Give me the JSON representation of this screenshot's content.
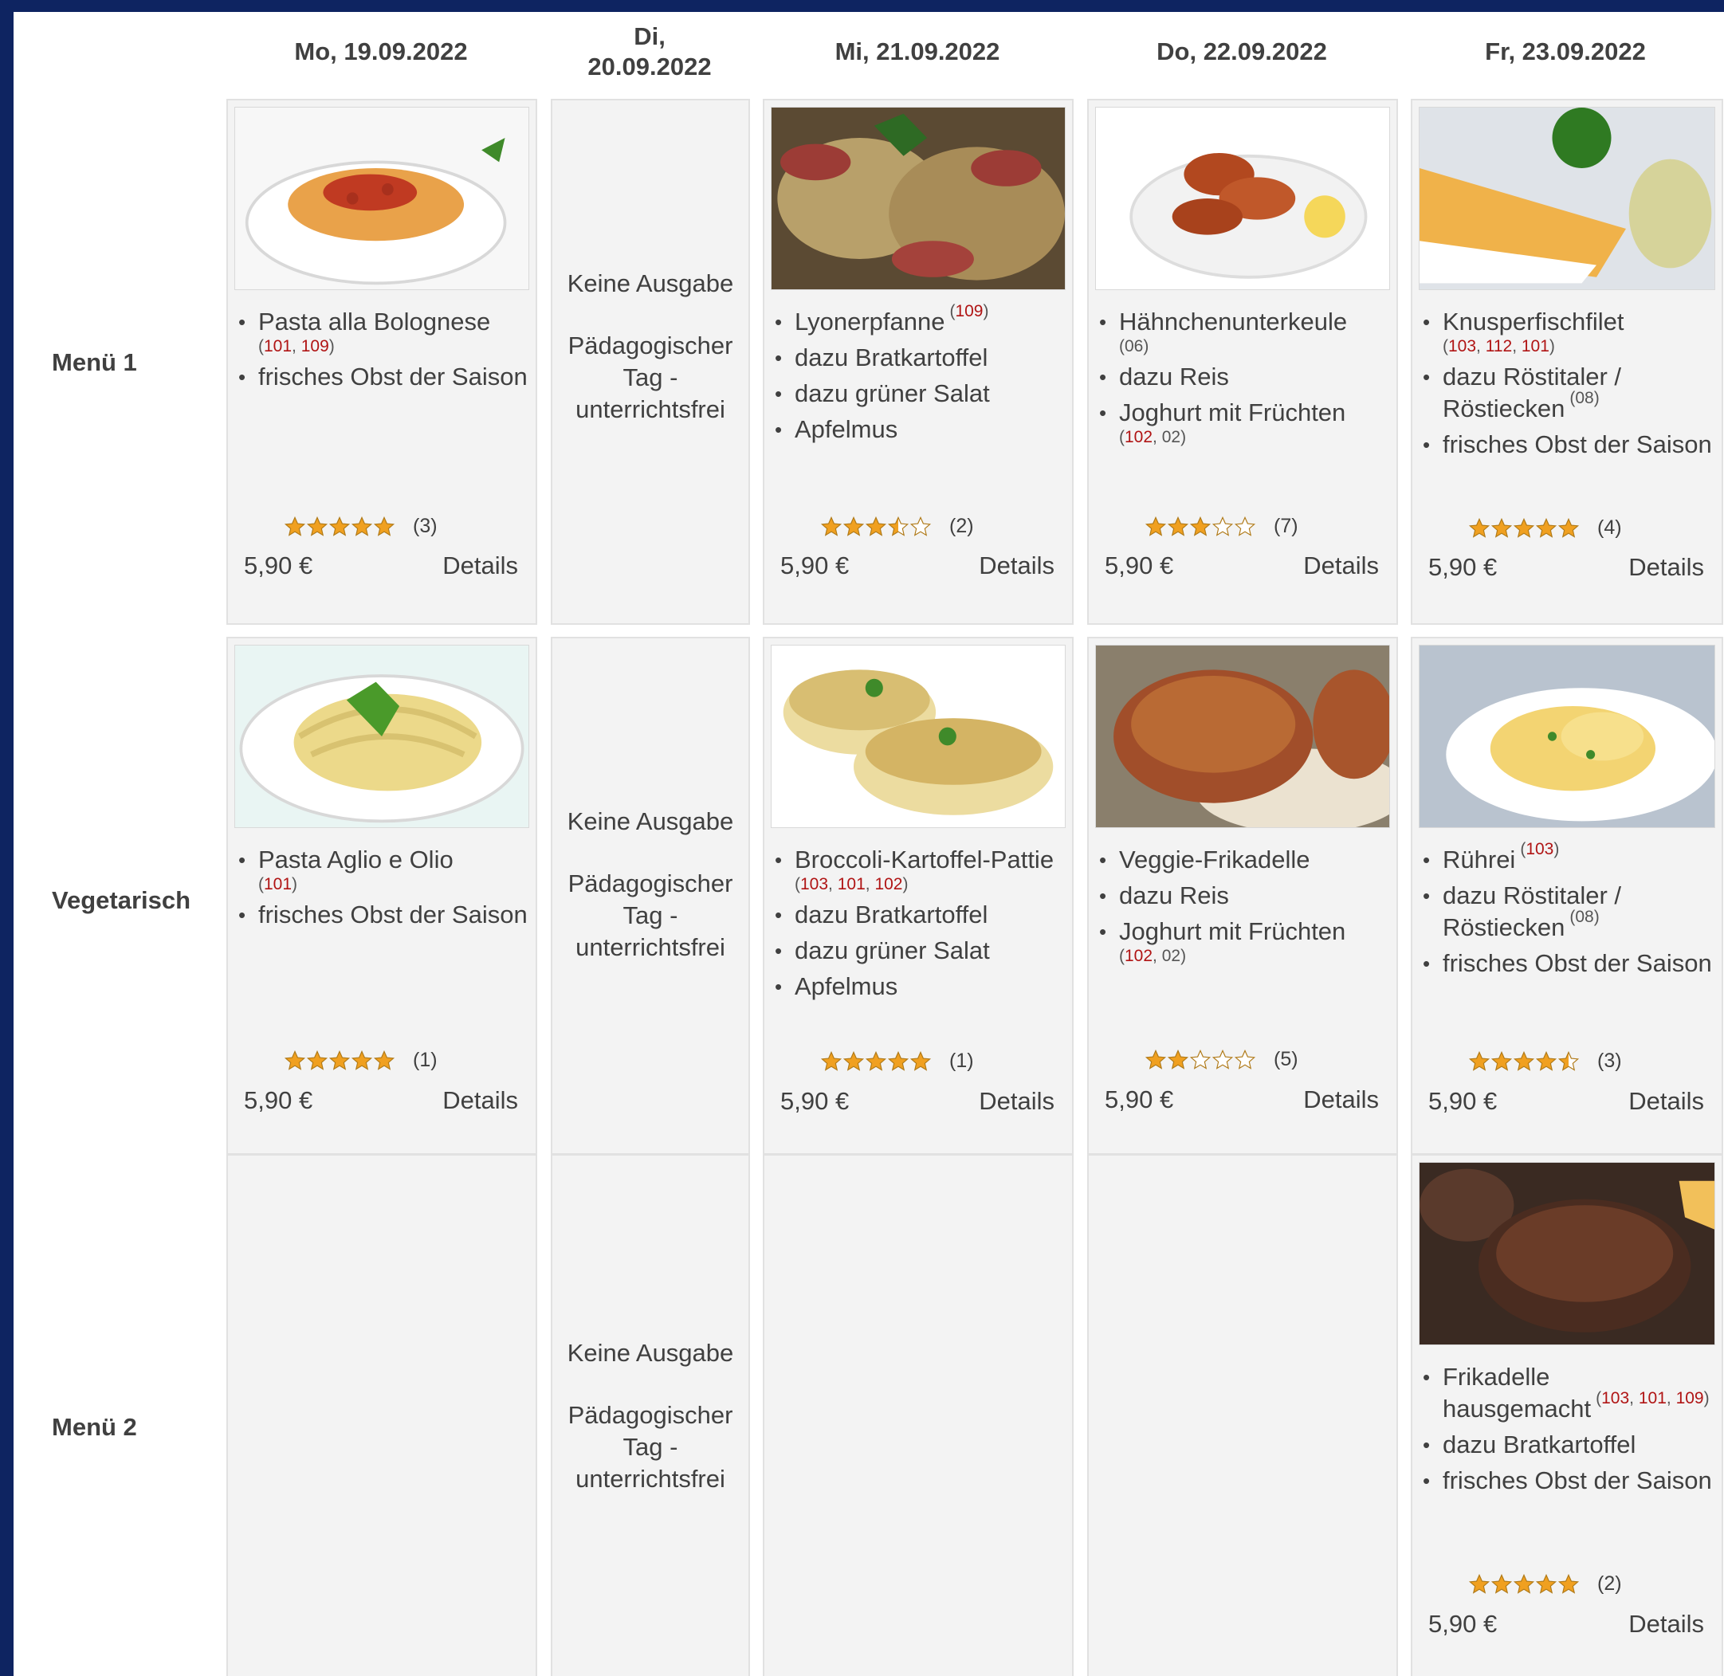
{
  "days": [
    {
      "label": "Mo, 19.09.2022"
    },
    {
      "label": "Di,\n20.09.2022"
    },
    {
      "label": "Mi, 21.09.2022"
    },
    {
      "label": "Do, 22.09.2022"
    },
    {
      "label": "Fr, 23.09.2022"
    }
  ],
  "rows": [
    {
      "label": "Menü 1"
    },
    {
      "label": "Vegetarisch"
    },
    {
      "label": "Menü 2"
    }
  ],
  "closed": {
    "line1": "Keine Ausgabe",
    "line2": "Pädagogischer Tag - unterrichtsfrei"
  },
  "details_label": "Details",
  "colors": {
    "background": "#0e2461",
    "card": "#f3f3f3",
    "allergen": "#b01414",
    "star": "#f0a020"
  },
  "cards": {
    "m1_mo": {
      "image_icon": "pasta-bolognese-photo",
      "dishes": [
        {
          "name": "Pasta alla Bolognese",
          "allergens": "(101, 109)"
        },
        {
          "name": "frisches Obst der Saison",
          "allergens": ""
        }
      ],
      "rating": 5,
      "rating_count": "(3)",
      "price": "5,90 €"
    },
    "m1_mi": {
      "image_icon": "lyonerpfanne-photo",
      "dishes": [
        {
          "name": "Lyonerpfanne",
          "allergens": "(109)"
        },
        {
          "name": "dazu Bratkartoffel",
          "allergens": ""
        },
        {
          "name": "dazu grüner Salat",
          "allergens": ""
        },
        {
          "name": "Apfelmus",
          "allergens": ""
        }
      ],
      "rating": 3.5,
      "rating_count": "(2)",
      "price": "5,90 €"
    },
    "m1_do": {
      "image_icon": "chicken-legs-photo",
      "dishes": [
        {
          "name": "Hähnchenunterkeule",
          "allergens": "(06)"
        },
        {
          "name": "dazu Reis",
          "allergens": ""
        },
        {
          "name": "Joghurt mit Früchten",
          "allergens": "(102, 02)"
        }
      ],
      "rating": 3,
      "rating_count": "(7)",
      "price": "5,90 €"
    },
    "m1_fr": {
      "image_icon": "fish-fillet-photo",
      "dishes": [
        {
          "name": "Knusperfischfilet",
          "allergens": "(103, 112, 101)"
        },
        {
          "name": "dazu Röstitaler / Röstiecken",
          "allergens": "(08)"
        },
        {
          "name": "frisches Obst der Saison",
          "allergens": ""
        }
      ],
      "rating": 5,
      "rating_count": "(4)",
      "price": "5,90 €"
    },
    "veg_mo": {
      "image_icon": "pasta-aglio-olio-photo",
      "dishes": [
        {
          "name": "Pasta Aglio e Olio",
          "allergens": "(101)"
        },
        {
          "name": "frisches Obst der Saison",
          "allergens": ""
        }
      ],
      "rating": 5,
      "rating_count": "(1)",
      "price": "5,90 €"
    },
    "veg_mi": {
      "image_icon": "broccoli-pattie-photo",
      "dishes": [
        {
          "name": "Broccoli-Kartoffel-Pattie",
          "allergens": "(103, 101, 102)"
        },
        {
          "name": "dazu Bratkartoffel",
          "allergens": ""
        },
        {
          "name": "dazu grüner Salat",
          "allergens": ""
        },
        {
          "name": "Apfelmus",
          "allergens": ""
        }
      ],
      "rating": 5,
      "rating_count": "(1)",
      "price": "5,90 €"
    },
    "veg_do": {
      "image_icon": "veggie-patty-photo",
      "dishes": [
        {
          "name": "Veggie-Frikadelle",
          "allergens": ""
        },
        {
          "name": "dazu Reis",
          "allergens": ""
        },
        {
          "name": "Joghurt mit Früchten",
          "allergens": "(102, 02)"
        }
      ],
      "rating": 2,
      "rating_count": "(5)",
      "price": "5,90 €"
    },
    "veg_fr": {
      "image_icon": "scrambled-eggs-photo",
      "dishes": [
        {
          "name": "Rührei",
          "allergens": "(103)"
        },
        {
          "name": "dazu Röstitaler / Röstiecken",
          "allergens": "(08)"
        },
        {
          "name": "frisches Obst der Saison",
          "allergens": ""
        }
      ],
      "rating": 4.5,
      "rating_count": "(3)",
      "price": "5,90 €"
    },
    "m2_fr": {
      "image_icon": "meat-patty-photo",
      "dishes": [
        {
          "name": "Frikadelle hausgemacht",
          "allergens": "(103, 101, 109)"
        },
        {
          "name": "dazu Bratkartoffel",
          "allergens": ""
        },
        {
          "name": "frisches Obst der Saison",
          "allergens": ""
        }
      ],
      "rating": 5,
      "rating_count": "(2)",
      "price": "5,90 €"
    }
  }
}
